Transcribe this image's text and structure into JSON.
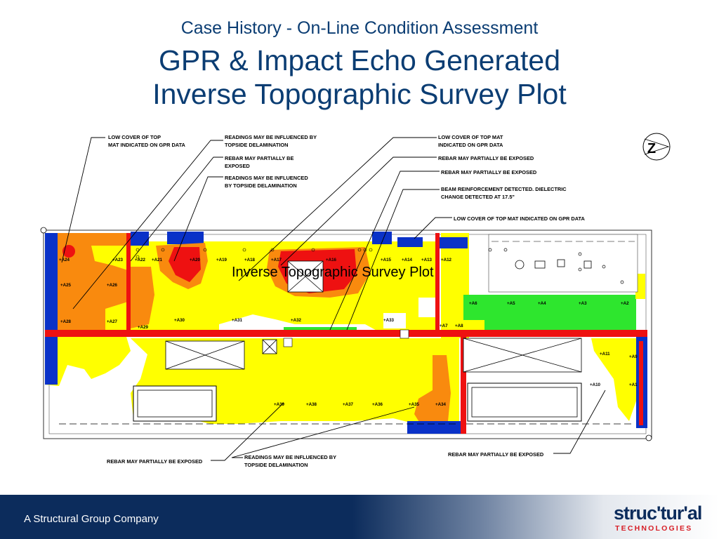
{
  "header": {
    "subtitle": "Case History - On-Line Condition Assessment",
    "title_line1": "GPR & Impact Echo Generated",
    "title_line2": "Inverse Topographic Survey Plot"
  },
  "plot": {
    "overlay_label": "Inverse Topographic Survey Plot",
    "north_label": "Z",
    "callouts": {
      "c1": [
        "LOW COVER OF TOP",
        "MAT INDICATED ON GPR DATA"
      ],
      "c2": [
        "READINGS MAY BE INFLUENCED BY",
        "TOPSIDE DELAMINATION"
      ],
      "c3": [
        "REBAR MAY PARTIALLY BE",
        "EXPOSED"
      ],
      "c4": [
        "READINGS MAY BE INFLUENCED",
        "BY TOPSIDE DELAMINATION"
      ],
      "c5": [
        "LOW COVER OF TOP MAT",
        "INDICATED ON GPR DATA"
      ],
      "c6": [
        "REBAR MAY PARTIALLY BE EXPOSED"
      ],
      "c7": [
        "REBAR MAY PARTIALLY BE EXPOSED"
      ],
      "c8": [
        "BEAM REINFORCEMENT DETECTED. DIELECTRIC",
        "CHANGE DETECTED AT 17.5\""
      ],
      "c9": [
        "LOW COVER OF TOP MAT INDICATED ON GPR DATA"
      ],
      "b1": [
        "REBAR MAY PARTIALLY BE EXPOSED"
      ],
      "b2": [
        "READINGS MAY BE INFLUENCED BY",
        "TOPSIDE DELAMINATION"
      ],
      "b3": [
        "REBAR MAY PARTIALLY BE EXPOSED"
      ]
    },
    "points": {
      "A24": "+A24",
      "A23": "+A23",
      "A22": "+A22",
      "A21": "+A21",
      "A20": "+A20",
      "A19": "+A19",
      "A18": "+A18",
      "A17": "+A17",
      "A16": "+A16",
      "A15": "+A15",
      "A14": "+A14",
      "A13": "+A13",
      "A12": "+A12",
      "A25": "+A25",
      "A26": "+A26",
      "A28": "+A28",
      "A27": "+A27",
      "A29": "+A29",
      "A30": "+A30",
      "A31": "+A31",
      "A32": "+A32",
      "A33": "+A33",
      "A7": "+A7",
      "A8": "+A8",
      "A6": "+A6",
      "A5": "+A5",
      "A4": "+A4",
      "A3": "+A3",
      "A2": "+A2",
      "A1": "+A1",
      "A11": "+A11",
      "A9": "+A9",
      "A10": "+A10",
      "A39": "+A39",
      "A38": "+A38",
      "A37": "+A37",
      "A36": "+A36",
      "A35": "+A35",
      "A34": "+A34"
    }
  },
  "footer": {
    "company_text": "A Structural Group Company",
    "logo_word": "struc'tur'al",
    "logo_sub": "TECHNOLOGIES"
  },
  "colors": {
    "title_blue": "#0b3d73",
    "map_yellow": "#ffff00",
    "map_orange": "#f98a0e",
    "map_red": "#ee1111",
    "map_blue": "#0a32c8",
    "map_green": "#2ee62e",
    "logo_red": "#d71e26"
  }
}
